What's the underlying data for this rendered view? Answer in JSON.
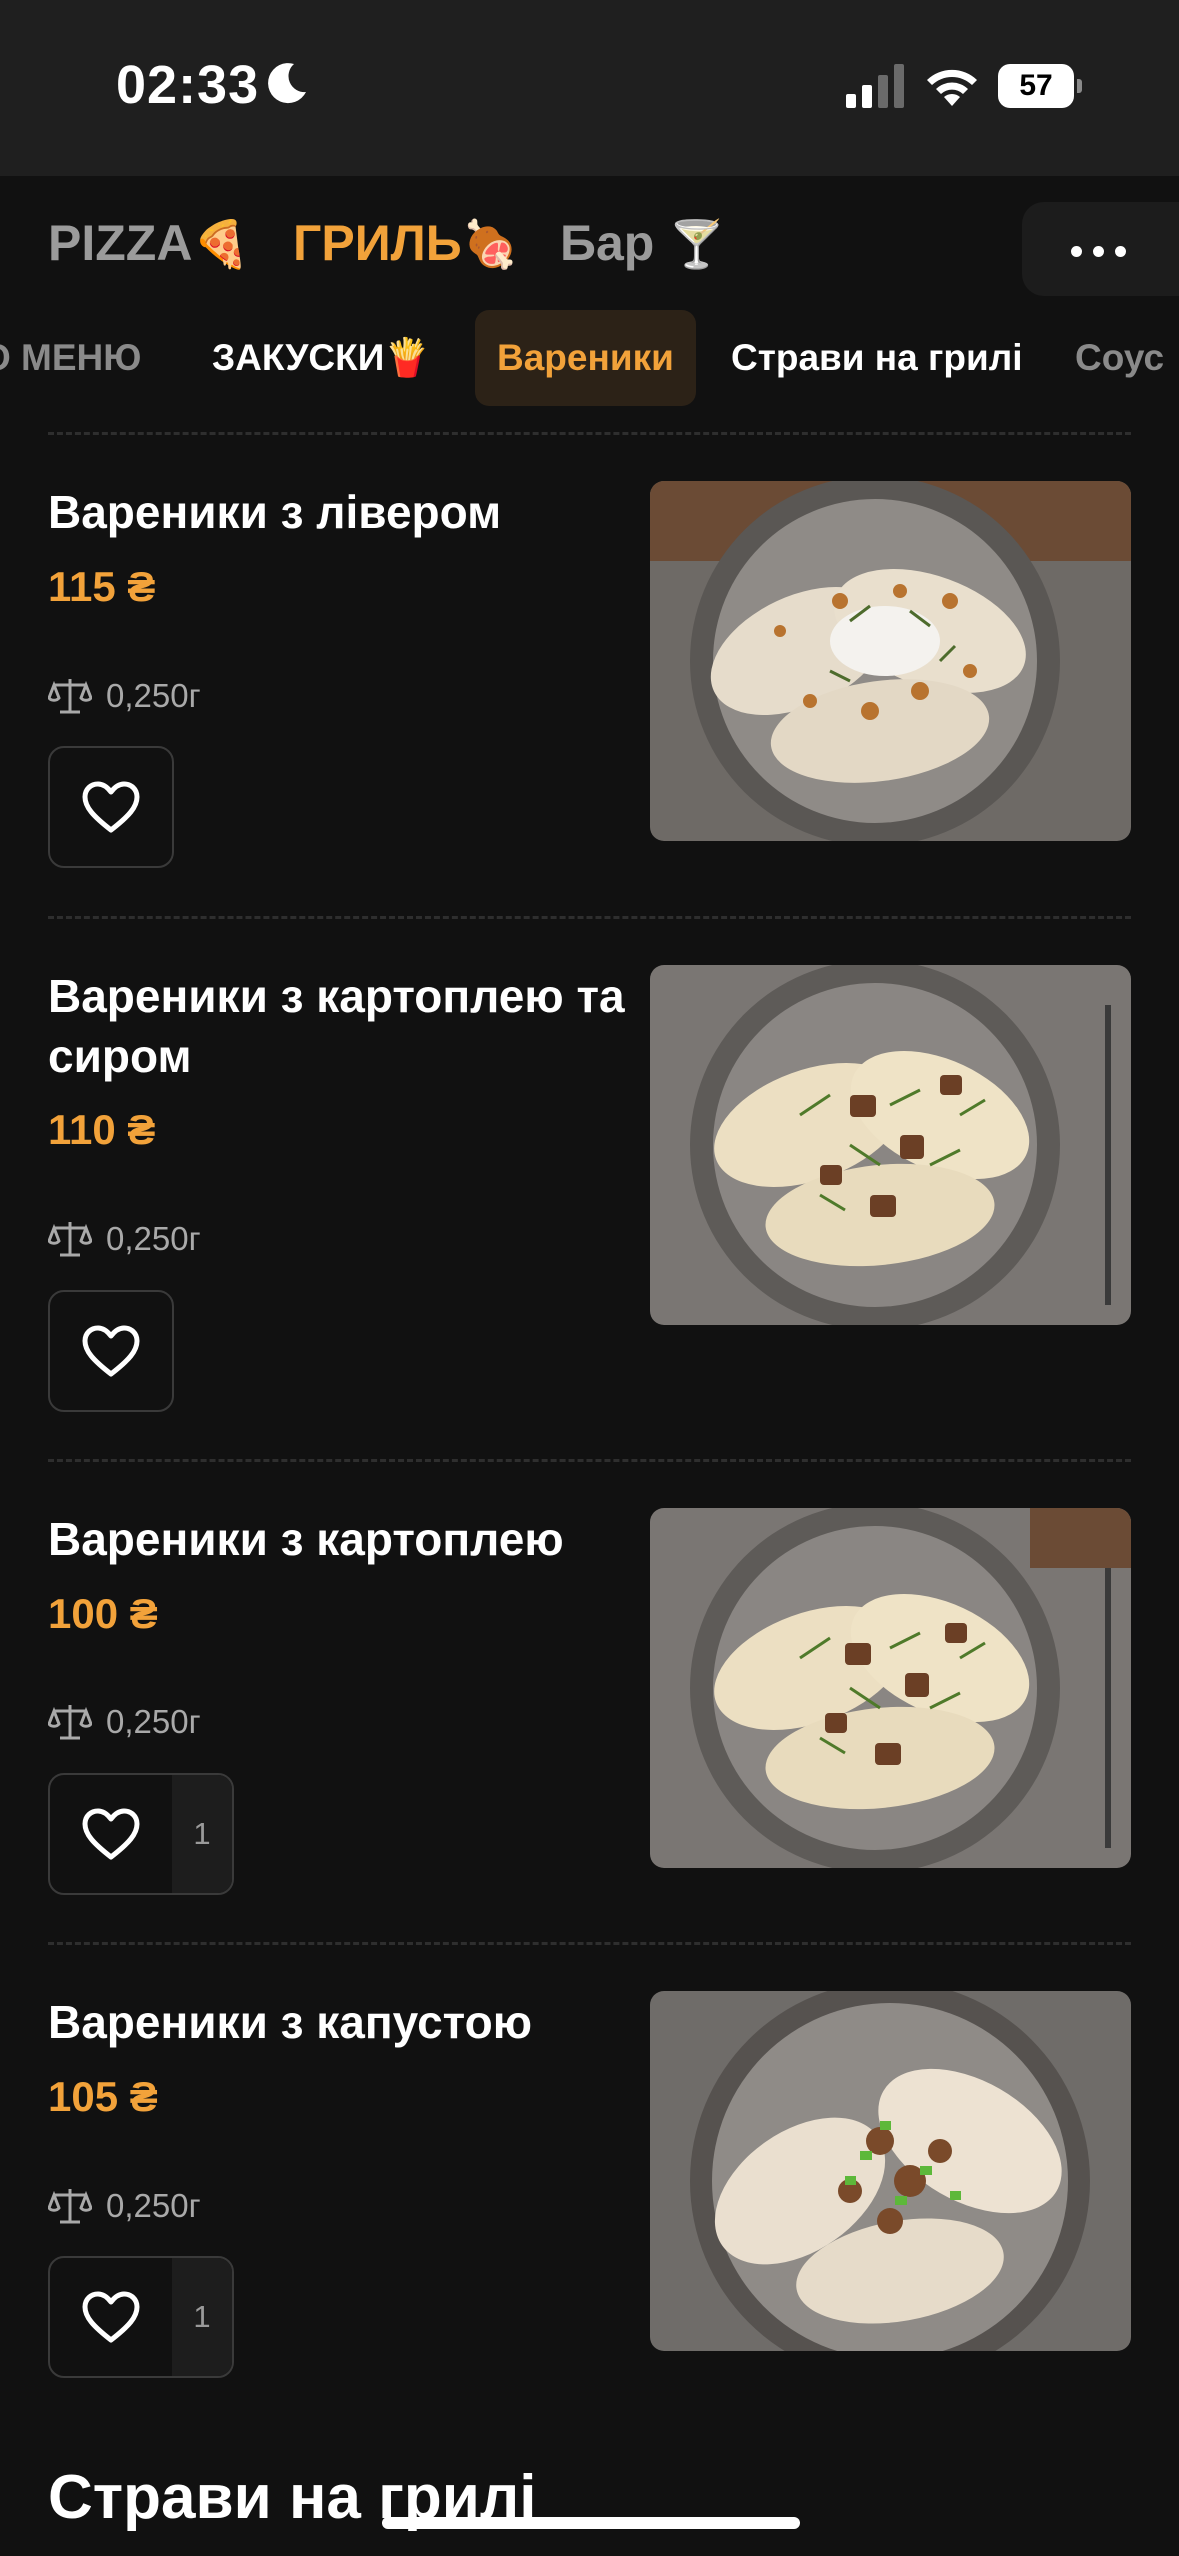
{
  "status_bar": {
    "time": "02:33",
    "battery": "57",
    "battery_level_percent": 57
  },
  "categories": [
    {
      "label": "PIZZA",
      "emoji": "🍕"
    },
    {
      "label": "ГРИЛЬ",
      "emoji": "🍖"
    },
    {
      "label": "Бар",
      "emoji": "🍸"
    }
  ],
  "subcategories": [
    {
      "label": "О МЕНЮ"
    },
    {
      "label": "ЗАКУСКИ🍟"
    },
    {
      "label": "Вареники"
    },
    {
      "label": "Страви на грилі"
    },
    {
      "label": "Соус"
    }
  ],
  "products": [
    {
      "name": "Вареники з лівером",
      "price": "115 ₴",
      "weight": "0,250г",
      "qty": ""
    },
    {
      "name": "Вареники з картоплею та сиром",
      "price": "110 ₴",
      "weight": "0,250г",
      "qty": ""
    },
    {
      "name": "Вареники з картоплею",
      "price": "100 ₴",
      "weight": "0,250г",
      "qty": "1"
    },
    {
      "name": "Вареники з капустою",
      "price": "105 ₴",
      "weight": "0,250г",
      "qty": "1"
    }
  ],
  "next_section_title": "Страви на грилі",
  "colors": {
    "accent": "#f2a23a",
    "background": "#111111",
    "status_bar": "#1f1f1f"
  }
}
